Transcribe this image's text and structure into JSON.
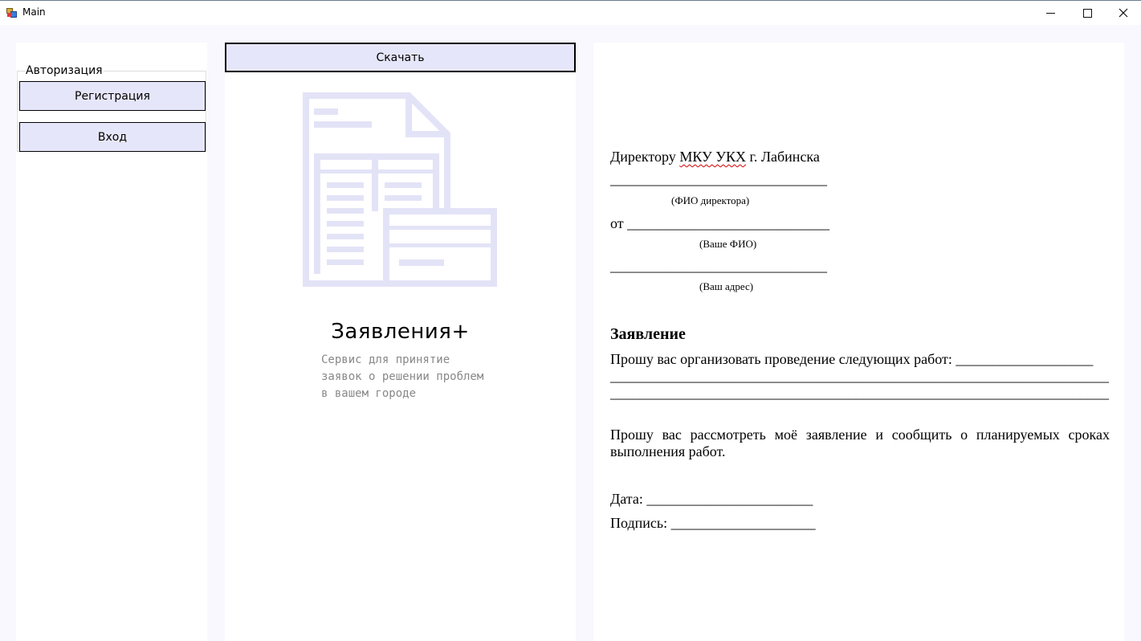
{
  "window": {
    "title": "Main",
    "icon": "app-form-icon",
    "controls": [
      "minimize-icon",
      "maximize-icon",
      "close-icon"
    ]
  },
  "auth": {
    "group_title": "Авторизация",
    "register_label": "Регистрация",
    "login_label": "Вход"
  },
  "main": {
    "download_label": "Скачать",
    "illustration_icon": "document-icon",
    "brand_title": "Заявления+",
    "brand_description": "Сервис для принятие\nзаявок о решении проблем\nв вашем городе"
  },
  "form": {
    "addressee_prefix": "Директору ",
    "addressee_org": "МКУ УКХ",
    "addressee_suffix": " г. Лабинска",
    "blank_director": "______________________________",
    "hint_director": "(ФИО директора)",
    "from_line": "от ____________________________",
    "hint_name": "(Ваше ФИО)",
    "blank_address": "______________________________",
    "hint_address": "(Ваш адрес)",
    "heading": "Заявление",
    "request_line1": "Прошу вас организовать проведение следующих работ: ___________________",
    "request_line2": "_____________________________________________________________________",
    "request_line3": "_____________________________________________________________________",
    "consider_text": "Прошу вас рассмотреть моё заявление и сообщить о планируемых сроках выполнения работ.",
    "date_line": "Дата: _______________________",
    "signature_line": "Подпись: ____________________"
  },
  "colors": {
    "button_bg": "#e6e6fa",
    "icon_color": "#e3e3f7",
    "window_bg": "#f8f8fe",
    "description_gray": "#888888"
  }
}
